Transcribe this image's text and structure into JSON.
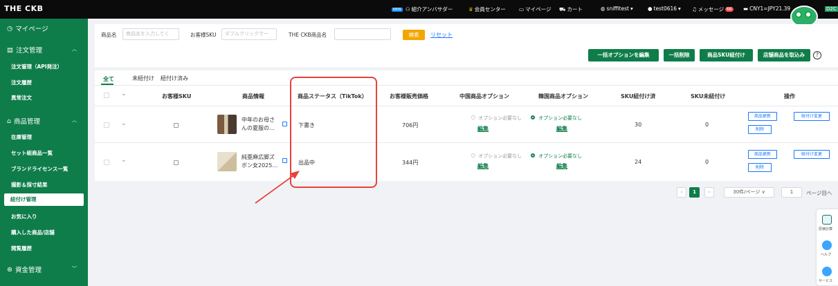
{
  "topbar": {
    "brand": "THE CKB",
    "new_badge": "NEW",
    "ambassador": "紹介アンバサダー",
    "member_center": "会員センター",
    "mypage": "マイページ",
    "cart": "カート",
    "shop": "sniffitest",
    "user": "test0616",
    "messages": "メッセージ",
    "message_count": "66",
    "currency": "CNY1=JPY21.39",
    "d2c": "D2C"
  },
  "sidebar": {
    "mypage": "マイページ",
    "order_group": "注文管理",
    "order_items": [
      "注文管理（API発注）",
      "注文履歴",
      "異常注文"
    ],
    "product_group": "商品管理",
    "product_items": [
      "在庫管理",
      "セット組商品一覧",
      "ブランドライセンス一覧",
      "撮影＆採寸結果",
      "紐付け管理",
      "お気に入り",
      "購入した商品/店舗",
      "閲覧履歴"
    ],
    "finance_group": "資金管理"
  },
  "filters": {
    "product_name_label": "商品名",
    "product_name_placeholder": "商品名を入力してく",
    "sku_label": "お客様SKU",
    "sku_placeholder": "ダブルクリックでー",
    "ckb_name_label": "THE CKB商品名",
    "ckb_name_value": "",
    "search_button": "検索",
    "reset_link": "リセット"
  },
  "actions": {
    "edit_options": "一括オプションを編集",
    "bulk_delete": "一括削除",
    "link_sku": "商品SKU紐付け",
    "import_store": "店舗商品を取込み",
    "help": "?"
  },
  "tabs": [
    "全て",
    "未紐付け",
    "紐付け済み"
  ],
  "table": {
    "headers": [
      "お客様SKU",
      "商品情報",
      "商品ステータス（TikTok）",
      "お客様販売価格",
      "中国商品オプション",
      "韓国商品オプション",
      "SKU紐付け済",
      "SKU未紐付け",
      "操作"
    ],
    "rows": [
      {
        "product_line1": "中年のお母さ",
        "product_line2": "んの夏服の…",
        "status": "下書き",
        "price": "706円",
        "cn_option": "オプション必要なし",
        "cn_edit": "編集",
        "kr_option": "オプション必要なし",
        "kr_edit": "編集",
        "linked": "30",
        "unlinked": "0",
        "btn_update": "商品更新",
        "btn_change": "紐付け変更",
        "btn_delete": "削除"
      },
      {
        "product_line1": "純亜麻広脚ズ",
        "product_line2": "ボン女2025…",
        "status": "出品中",
        "price": "344円",
        "cn_option": "オプション必要なし",
        "cn_edit": "編集",
        "kr_option": "オプション必要なし",
        "kr_edit": "編集",
        "linked": "24",
        "unlinked": "0",
        "btn_update": "商品更新",
        "btn_change": "紐付け変更",
        "btn_delete": "削除"
      }
    ]
  },
  "pagination": {
    "current": "1",
    "per_page": "30件/ページ",
    "jump_value": "1",
    "jump_suffix": "ページ目へ"
  },
  "fab": {
    "calc": "原価計算",
    "help": "ヘルプ",
    "service": "サービス"
  },
  "colors": {
    "brand_green": "#0e7d4a",
    "search_orange": "#f2a600",
    "link_blue": "#1677ff",
    "highlight_red": "#e8413a"
  }
}
